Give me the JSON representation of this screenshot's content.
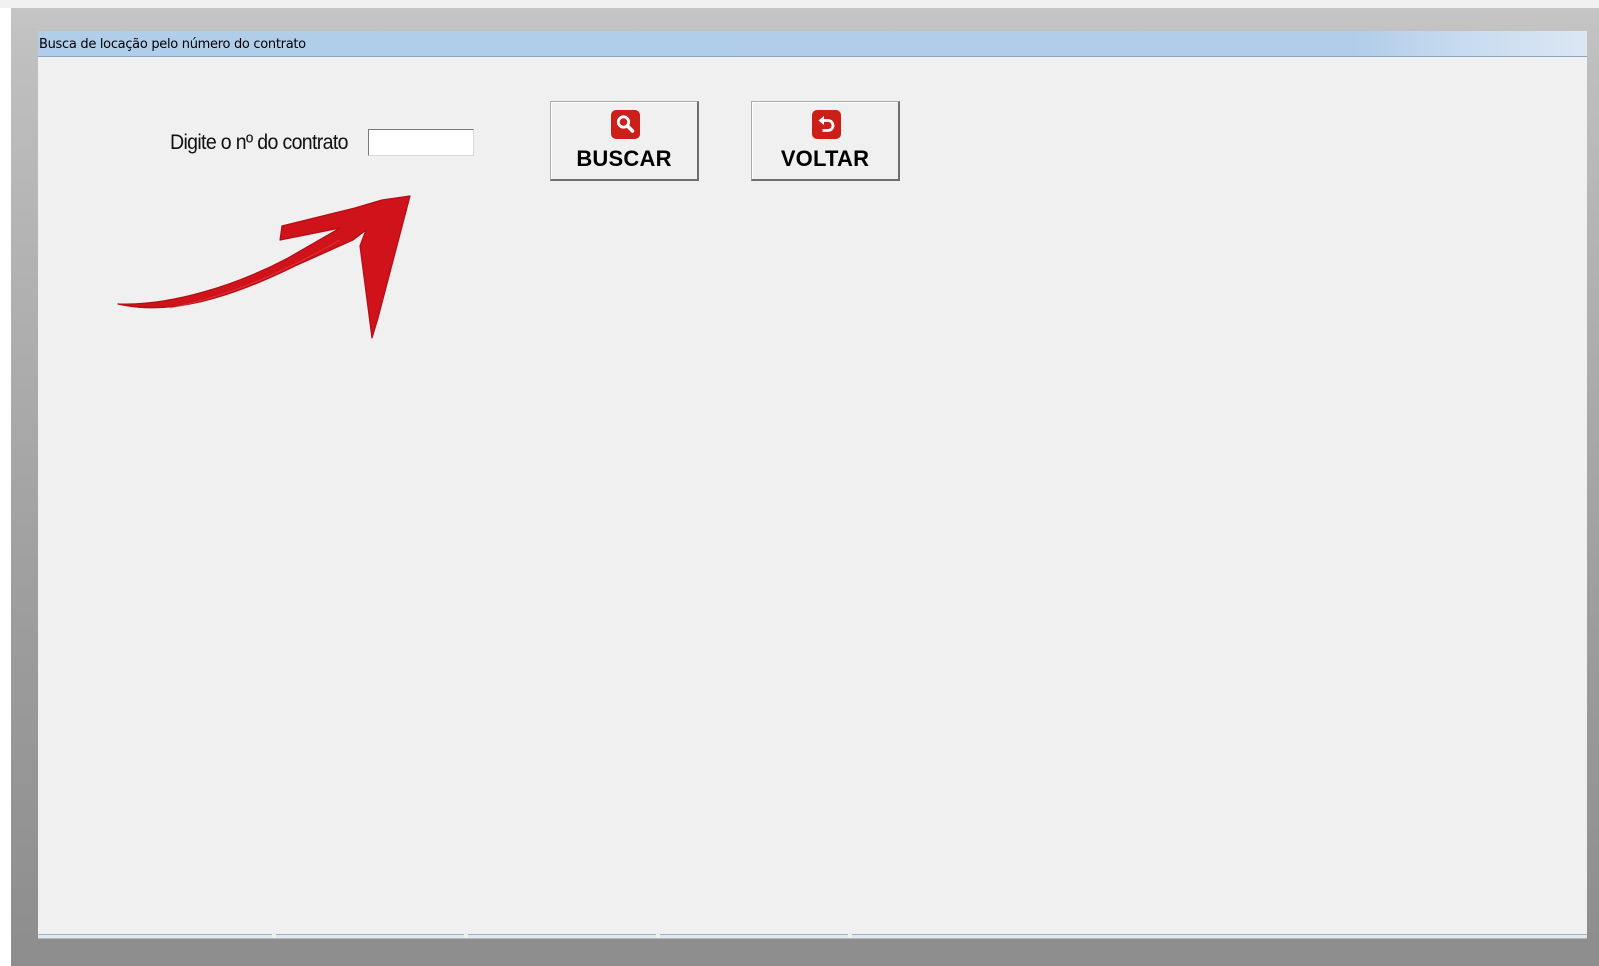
{
  "window": {
    "title": "Busca de locação pelo número do contrato"
  },
  "form": {
    "contract_label": "Digite o nº do contrato",
    "contract_value": "",
    "contract_placeholder": ""
  },
  "buttons": {
    "search": {
      "label": "BUSCAR",
      "icon": "search-icon"
    },
    "back": {
      "label": "VOLTAR",
      "icon": "back-arrow-icon"
    }
  },
  "annotation": {
    "icon": "red-arrow-annotation",
    "color": "#d0121b"
  },
  "colors": {
    "icon_red": "#cc1f1a",
    "title_bar": "#b1cde9",
    "window_bg": "#f0f0f0"
  }
}
